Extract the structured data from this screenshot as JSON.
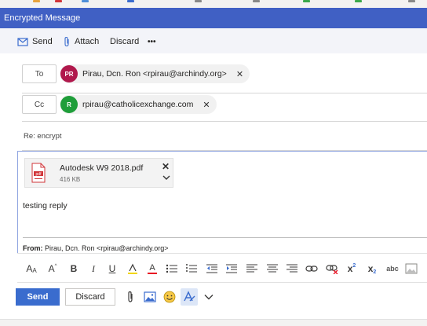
{
  "window": {
    "title": "Encrypted Message"
  },
  "toolbar": {
    "send_label": "Send",
    "attach_label": "Attach",
    "discard_label": "Discard",
    "more_label": "•••"
  },
  "to": {
    "label": "To",
    "recipient": {
      "initials": "PR",
      "text": "Pirau, Dcn. Ron <rpirau@archindy.org>",
      "color": "#b0184c"
    },
    "remove": "✕"
  },
  "cc": {
    "label": "Cc",
    "recipient": {
      "initials": "R",
      "text": "rpirau@catholicexchange.com",
      "color": "#1f9e3a"
    },
    "remove": "✕"
  },
  "subject": "Re: encrypt",
  "attachment": {
    "name": "Autodesk W9 2018.pdf",
    "size": "416 KB",
    "type_label": "pdf"
  },
  "body": {
    "text": "testing reply",
    "quoted_from_label": "From:",
    "quoted_from_value": "Pirau, Dcn. Ron <rpirau@archindy.org>"
  },
  "format_toolbar": {
    "icons": [
      "font-size-icon",
      "grow-font-icon",
      "bold-icon",
      "italic-icon",
      "underline-icon",
      "highlight-icon",
      "font-color-icon",
      "bullets-icon",
      "numbering-icon",
      "decrease-indent-icon",
      "increase-indent-icon",
      "align-left-icon",
      "align-center-icon",
      "align-right-icon",
      "insert-link-icon",
      "remove-link-icon",
      "superscript-icon",
      "subscript-icon",
      "spelling-icon",
      "insert-picture-icon"
    ],
    "bold": "B",
    "italic": "I",
    "underline": "U",
    "font_color": "A",
    "superscript": "x",
    "superscript_mark": "2",
    "subscript": "x",
    "subscript_mark": "2",
    "spelling": "abc"
  },
  "actions": {
    "send_label": "Send",
    "discard_label": "Discard"
  },
  "colors": {
    "accent": "#4060c4",
    "send_button": "#3a6cce",
    "pdf_icon": "#d13438"
  }
}
